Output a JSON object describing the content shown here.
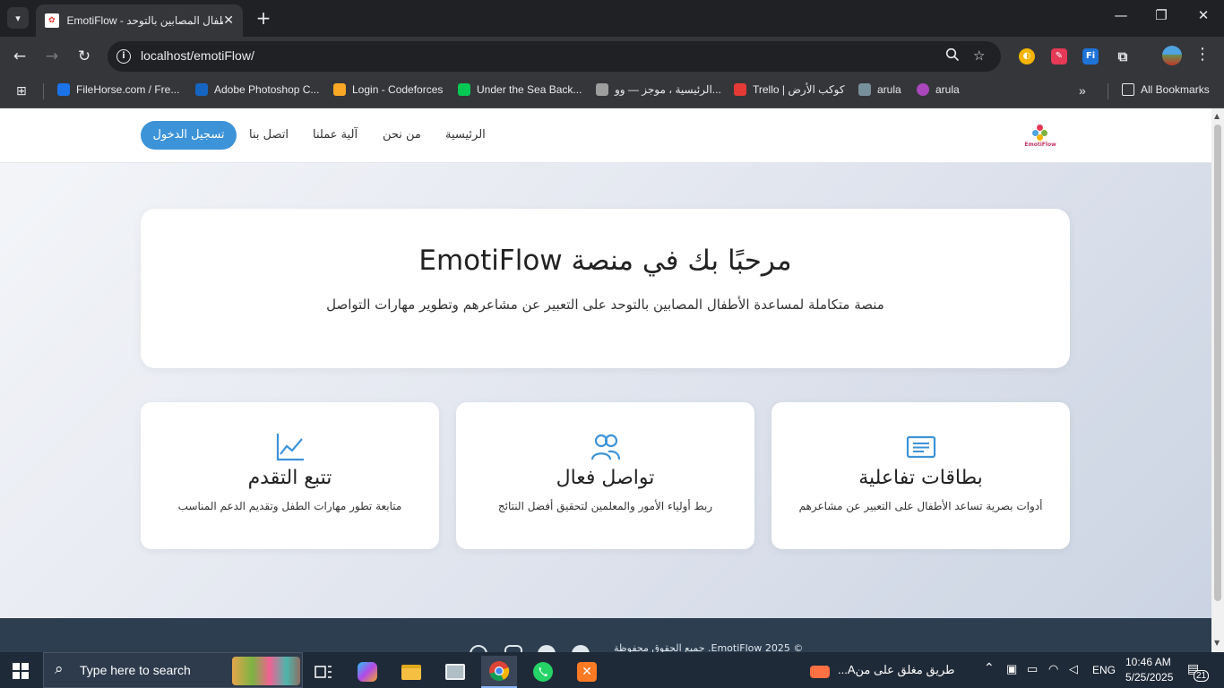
{
  "browser": {
    "tab_title": "EmotiFlow - منصة الأطفال المصابين بالتوحد",
    "url": "localhost/emotiFlow/",
    "bookmarks": [
      {
        "label": "FileHorse.com / Fre...",
        "color": "#1a73e8"
      },
      {
        "label": "Adobe Photoshop C...",
        "color": "#1565c0"
      },
      {
        "label": "Login - Codeforces",
        "color": "#f9a825"
      },
      {
        "label": "Under the Sea Back...",
        "color": "#00c853"
      },
      {
        "label": "الرئيسية ، موجز — وو...",
        "color": "#9e9e9e"
      },
      {
        "label": "Trello | كوكب الأرض",
        "color": "#e53935"
      },
      {
        "label": "arula",
        "color": "#78909c"
      },
      {
        "label": "arula",
        "color": "#ab47bc"
      }
    ],
    "all_bookmarks_label": "All Bookmarks"
  },
  "site": {
    "logo_text": "EmotiFlow",
    "login_label": "تسجيل الدخول",
    "nav": {
      "home": "الرئيسية",
      "about": "من نحن",
      "how": "آلية عملنا",
      "contact": "اتصل بنا"
    },
    "hero": {
      "title": "مرحبًا بك في منصة EmotiFlow",
      "subtitle": "منصة متكاملة لمساعدة الأطفال المصابين بالتوحد على التعبير عن مشاعرهم وتطوير مهارات التواصل"
    },
    "features": [
      {
        "icon": "chart-line-icon",
        "title": "تتبع التقدم",
        "desc": "متابعة تطور مهارات الطفل وتقديم الدعم المناسب"
      },
      {
        "icon": "users-icon",
        "title": "تواصل فعال",
        "desc": "ربط أولياء الأمور والمعلمين لتحقيق أفضل النتائج"
      },
      {
        "icon": "card-text-icon",
        "title": "بطاقات تفاعلية",
        "desc": "أدوات بصرية تساعد الأطفال على التعبير عن مشاعرهم"
      }
    ],
    "footer_copy": "© 2025 EmotiFlow. جميع الحقوق محفوظة",
    "accent": "#3d93d8"
  },
  "taskbar": {
    "search_placeholder": "Type here to search",
    "notification": "طريق مغلق على منA...",
    "language": "ENG",
    "time": "10:46 AM",
    "date": "5/25/2025",
    "notif_count": "21"
  }
}
